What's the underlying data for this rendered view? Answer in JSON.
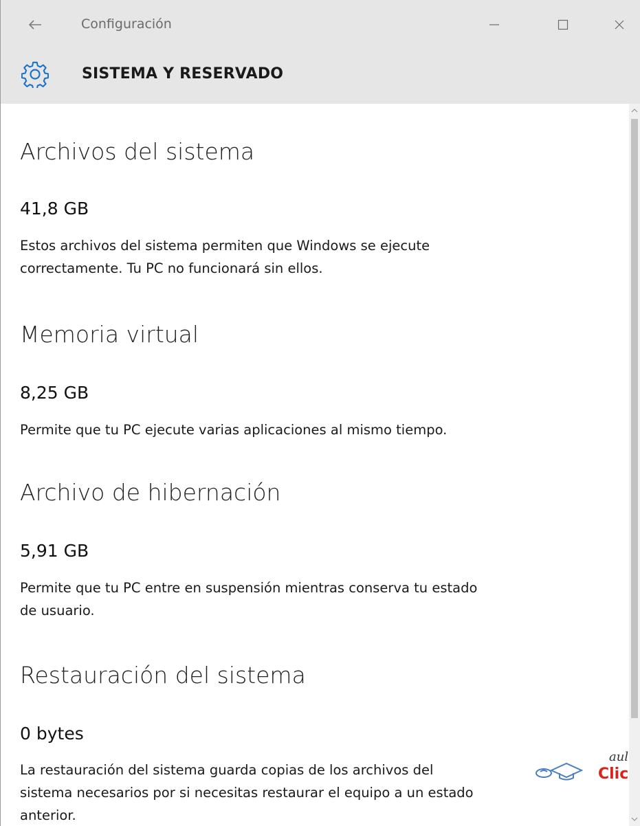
{
  "window": {
    "title": "Configuración",
    "controls": {
      "minimize": "minimize-icon",
      "maximize": "maximize-icon",
      "close": "close-icon"
    }
  },
  "header": {
    "icon": "gear-icon",
    "title": "SISTEMA Y RESERVADO",
    "accent": "#1a73c8"
  },
  "sections": [
    {
      "title": "Archivos del sistema",
      "size": "41,8 GB",
      "description_lines": [
        "Estos archivos del sistema permiten que Windows se ejecute",
        "correctamente. Tu PC no funcionará sin ellos."
      ]
    },
    {
      "title": "Memoria virtual",
      "size": "8,25 GB",
      "description_lines": [
        "Permite que tu PC ejecute varias aplicaciones al mismo tiempo."
      ]
    },
    {
      "title": "Archivo de hibernación",
      "size": "5,91 GB",
      "description_lines": [
        "Permite que tu PC entre en suspensión mientras conserva tu estado",
        "de usuario."
      ]
    },
    {
      "title": "Restauración del sistema",
      "size": "0 bytes",
      "description_lines": [
        "La restauración del sistema guarda copias de los archivos del",
        "sistema necesarios por si necesitas restaurar el equipo a un estado",
        "anterior."
      ]
    }
  ],
  "watermark": {
    "text_top": "aula",
    "text_bottom": "Clic",
    "color": "#d9241c"
  }
}
